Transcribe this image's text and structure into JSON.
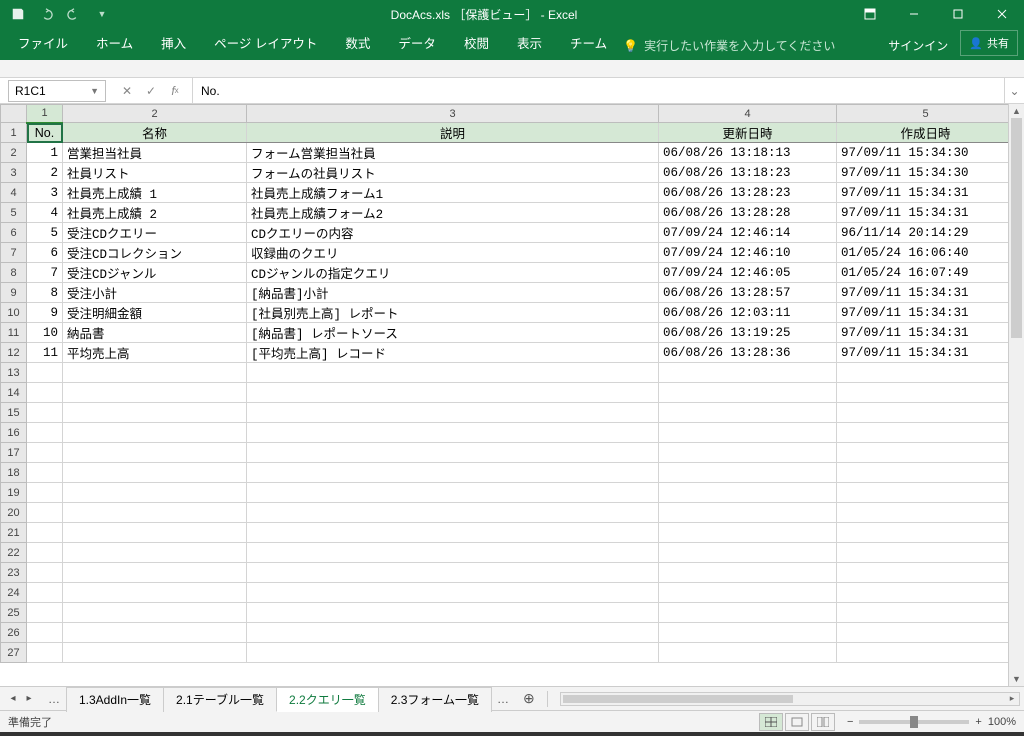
{
  "title": "DocAcs.xls ［保護ビュー］ - Excel",
  "qat": {
    "save": "save",
    "undo": "undo",
    "redo": "redo"
  },
  "ribbon_tabs": [
    "ファイル",
    "ホーム",
    "挿入",
    "ページ レイアウト",
    "数式",
    "データ",
    "校閲",
    "表示",
    "チーム"
  ],
  "tell_me": "実行したい作業を入力してください",
  "signin": "サインイン",
  "share": "共有",
  "name_box": "R1C1",
  "fx_value": "No.",
  "col_headers": [
    "1",
    "2",
    "3",
    "4",
    "5"
  ],
  "header_row": [
    "No.",
    "名称",
    "説明",
    "更新日時",
    "作成日時"
  ],
  "rows": [
    {
      "n": "1",
      "name": "営業担当社員",
      "desc": "フォーム営業担当社員",
      "upd": "06/08/26 13:18:13",
      "cre": "97/09/11 15:34:30"
    },
    {
      "n": "2",
      "name": "社員リスト",
      "desc": "フォームの社員リスト",
      "upd": "06/08/26 13:18:23",
      "cre": "97/09/11 15:34:30"
    },
    {
      "n": "3",
      "name": "社員売上成績 1",
      "desc": "社員売上成績フォーム1",
      "upd": "06/08/26 13:28:23",
      "cre": "97/09/11 15:34:31"
    },
    {
      "n": "4",
      "name": "社員売上成績 2",
      "desc": "社員売上成績フォーム2",
      "upd": "06/08/26 13:28:28",
      "cre": "97/09/11 15:34:31"
    },
    {
      "n": "5",
      "name": "受注CDクエリー",
      "desc": "CDクエリーの内容",
      "upd": "07/09/24 12:46:14",
      "cre": "96/11/14 20:14:29"
    },
    {
      "n": "6",
      "name": "受注CDコレクション",
      "desc": "収録曲のクエリ",
      "upd": "07/09/24 12:46:10",
      "cre": "01/05/24 16:06:40"
    },
    {
      "n": "7",
      "name": "受注CDジャンル",
      "desc": "CDジャンルの指定クエリ",
      "upd": "07/09/24 12:46:05",
      "cre": "01/05/24 16:07:49"
    },
    {
      "n": "8",
      "name": "受注小計",
      "desc": "[納品書]小計",
      "upd": "06/08/26 13:28:57",
      "cre": "97/09/11 15:34:31"
    },
    {
      "n": "9",
      "name": "受注明細金額",
      "desc": "[社員別売上高] レポート",
      "upd": "06/08/26 12:03:11",
      "cre": "97/09/11 15:34:31"
    },
    {
      "n": "10",
      "name": "納品書",
      "desc": "[納品書] レポートソース",
      "upd": "06/08/26 13:19:25",
      "cre": "97/09/11 15:34:31"
    },
    {
      "n": "11",
      "name": "平均売上高",
      "desc": "[平均売上高] レコード",
      "upd": "06/08/26 13:28:36",
      "cre": "97/09/11 15:34:31"
    }
  ],
  "empty_rows": 15,
  "sheet_tabs": [
    "1.3AddIn一覧",
    "2.1テーブル一覧",
    "2.2クエリ一覧",
    "2.3フォーム一覧"
  ],
  "active_tab": 2,
  "status": "準備完了",
  "zoom": "100%"
}
